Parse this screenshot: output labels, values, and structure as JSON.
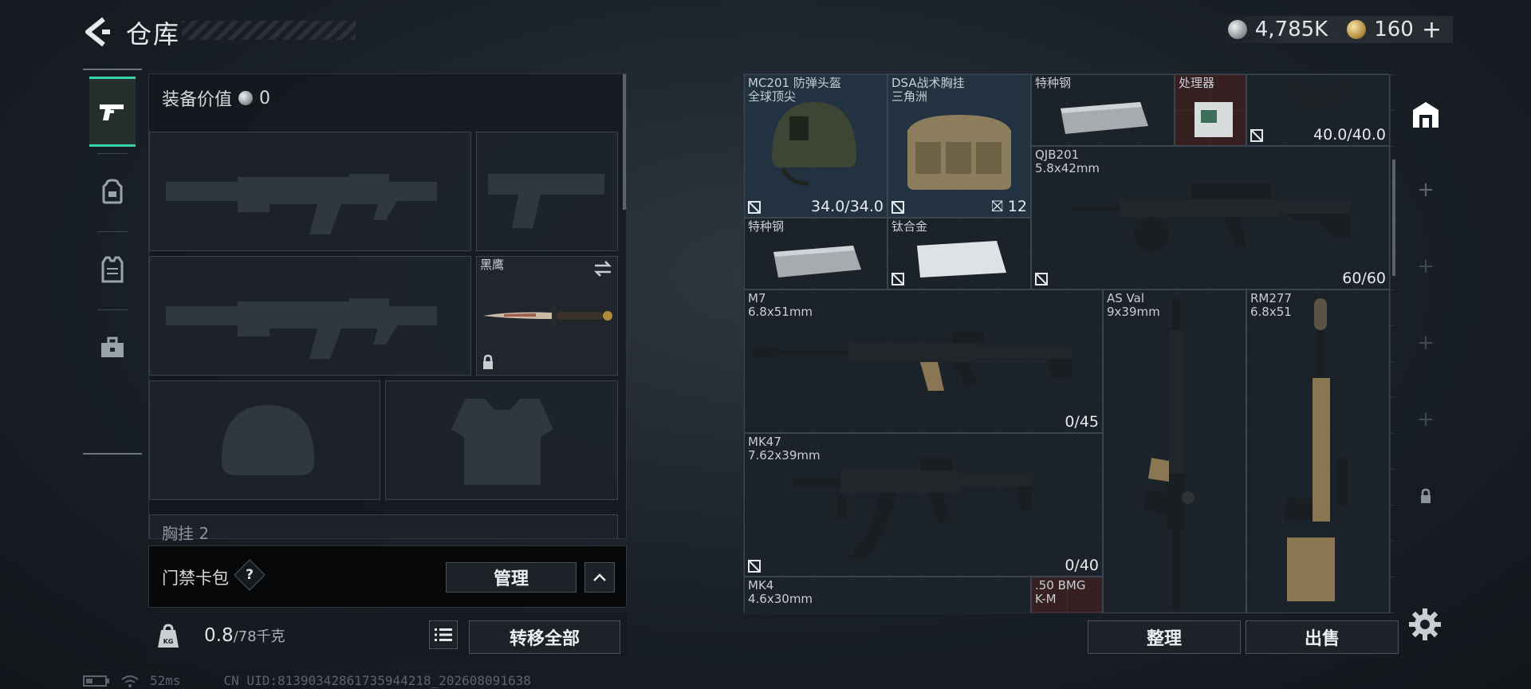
{
  "header": {
    "title": "仓库",
    "currency_silver": "4,785K",
    "currency_gold": "160",
    "currency_plus": "+"
  },
  "left_nav": [
    "pistol-icon",
    "backpack-icon",
    "armor-vest-icon",
    "case-icon"
  ],
  "equipment": {
    "value_label": "装备价值",
    "value": "0",
    "knife_label": "黑鹰",
    "partial_label": "胸挂 2"
  },
  "card_pack": {
    "title": "门禁卡包",
    "help": "?",
    "manage_label": "管理"
  },
  "weight": {
    "current": "0.8",
    "max": "/78千克",
    "transfer_all_label": "转移全部"
  },
  "status": {
    "ping": "52ms",
    "uid": "CN UID:81390342861735944218_202608091638"
  },
  "storage": {
    "items": [
      {
        "name": "MC201 防弹头盔",
        "sub": "全球顶尖",
        "stat": "34.0/34.0"
      },
      {
        "name": "DSA战术胸挂",
        "sub": "三角洲",
        "stat": "12"
      },
      {
        "name": "特种钢",
        "sub": "",
        "stat": ""
      },
      {
        "name": "处理器",
        "sub": "",
        "stat": ""
      },
      {
        "name": "",
        "sub": "",
        "stat": "40.0/40.0"
      },
      {
        "name": "QJB201",
        "sub": "5.8x42mm",
        "stat": "60/60"
      },
      {
        "name": "特种钢",
        "sub": "",
        "stat": ""
      },
      {
        "name": "钛合金",
        "sub": "",
        "stat": ""
      },
      {
        "name": "M7",
        "sub": "6.8x51mm",
        "stat": "0/45"
      },
      {
        "name": "AS Val",
        "sub": "9x39mm",
        "stat": ""
      },
      {
        "name": "RM277",
        "sub": "6.8x51",
        "stat": ""
      },
      {
        "name": "MK47",
        "sub": "7.62x39mm",
        "stat": "0/40"
      },
      {
        "name": "MK4",
        "sub": "4.6x30mm",
        "stat": ""
      },
      {
        "name": ".50 BMG",
        "sub": "K-M",
        "stat": ""
      }
    ],
    "sort_label": "整理",
    "sell_label": "出售"
  },
  "right_nav": [
    "storage-icon",
    "plus-icon",
    "plus-icon",
    "plus-icon",
    "plus-icon",
    "lock-icon"
  ]
}
